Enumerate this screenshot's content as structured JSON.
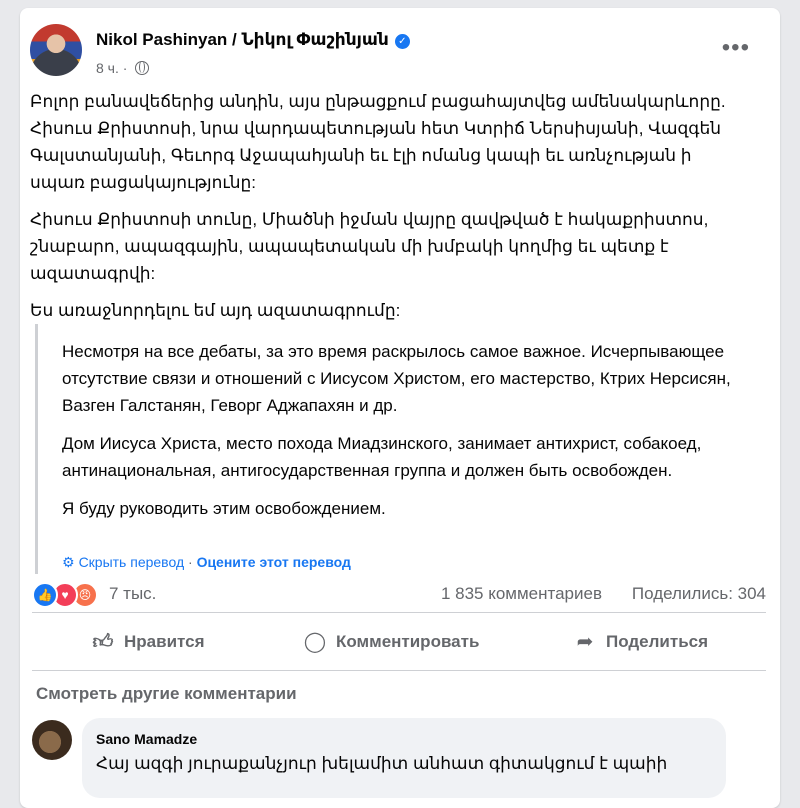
{
  "post": {
    "author": "Nikol Pashinyan / Նիկոլ Փաշինյան",
    "time": "8 ч.",
    "paragraphs": [
      "Բոլոր բանավեճերից անդին, այս ընթացքում բացահայտվեց ամենակարևորը. Հիսուս Քրիստոսի, նրա վարդապետության հետ Կտրիճ Ներսիսյանի, Վազգեն Գալստանյանի, Գեւորգ Աջապահյանի եւ էլի ոմանց կապի եւ առնչության ի սպառ բացակայությունը:",
      "Հիսուս Քրիստոսի տունը, Միածնի իջման վայրը զավթված է հակաքրիստոս, շնաբարո, ապազգային, ապապետական մի խմբակի կողմից եւ պետք է ազատագրվի:",
      "Ես առաջնորդելու եմ այդ ազատագրումը:"
    ]
  },
  "translation": {
    "paragraphs": [
      "Несмотря на все дебаты, за это время раскрылось самое важное. Исчерпывающее отсутствие связи и отношений с Иисусом Христом, его мастерство, Ктрих Нерсисян, Вазген Галстанян, Геворг Аджапахян и др.",
      "Дом Иисуса Христа, место похода Миадзинского, занимает антихрист, собакоед, антинациональная, антигосударственная группа и должен быть освобожден.",
      "Я буду руководить этим освобождением."
    ],
    "hide_label": "Скрыть перевод",
    "separator": "·",
    "rate_label": "Оцените этот перевод"
  },
  "stats": {
    "reactions_count": "7 тыс.",
    "comments": "1 835 комментариев",
    "shares": "Поделились: 304"
  },
  "actions": {
    "like": "Нравится",
    "comment": "Комментировать",
    "share": "Поделиться"
  },
  "comments": {
    "view_more": "Смотреть другие комментарии",
    "first": {
      "author": "Sano Mamadze",
      "text": "Հայ ազգի յուրաքանչյուր խելամիտ անհատ գիտակցում է պաիի"
    }
  },
  "colors": {
    "accent": "#1877f2",
    "like": "#1877f2",
    "love": "#f33e58",
    "angry": "#f7714c"
  }
}
